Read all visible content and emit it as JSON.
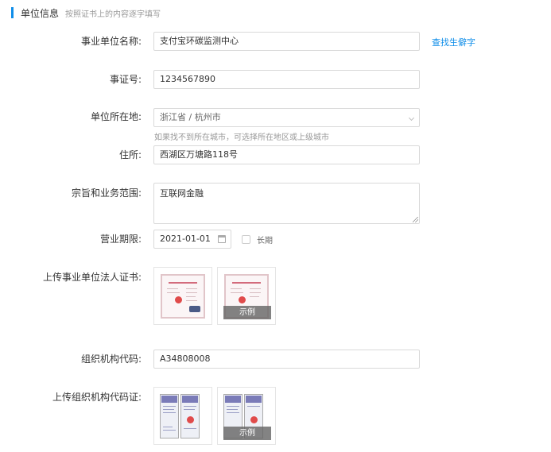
{
  "section": {
    "title": "单位信息",
    "subtitle": "按照证书上的内容逐字填写"
  },
  "form": {
    "unit_name": {
      "label": "事业单位名称:",
      "value": "支付宝环碳监测中心"
    },
    "find_rare_char_link": "查找生僻字",
    "cert_no": {
      "label": "事证号:",
      "value": "1234567890"
    },
    "location": {
      "label": "单位所在地:",
      "value": "浙江省 / 杭州市",
      "hint": "如果找不到所在城市，可选择所在地区或上级城市"
    },
    "address": {
      "label": "住所:",
      "value": "西湖区万塘路118号"
    },
    "purpose": {
      "label": "宗旨和业务范围:",
      "value": "互联网金融"
    },
    "business_term": {
      "label": "营业期限:",
      "value": "2021-01-01",
      "long_term_label": "长期",
      "long_term_checked": false
    },
    "upload_legal_cert": {
      "label": "上传事业单位法人证书:"
    },
    "org_code": {
      "label": "组织机构代码:",
      "value": "A34808008"
    },
    "upload_org_code_cert": {
      "label": "上传组织机构代码证:"
    }
  },
  "example_label": "示例",
  "icons": {
    "select_arrow": "chevron-down-icon",
    "calendar": "calendar-icon"
  },
  "colors": {
    "accent": "#108ee9",
    "hint": "#999999"
  }
}
